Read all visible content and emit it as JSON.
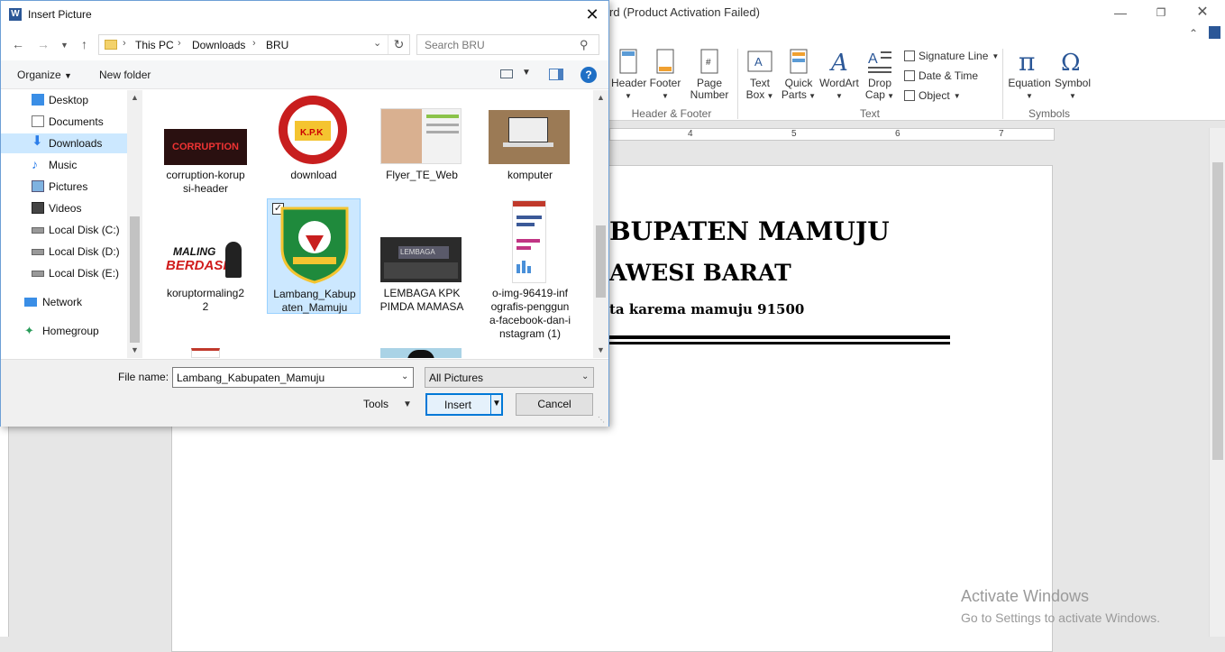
{
  "word": {
    "title": "rd (Product Activation Failed)",
    "ribbon": {
      "header_footer": {
        "header": "Header",
        "footer": "Footer",
        "page_number_line1": "Page",
        "page_number_line2": "Number",
        "group_label": "Header & Footer"
      },
      "text": {
        "text_box_line1": "Text",
        "text_box_line2": "Box",
        "quick_parts_line1": "Quick",
        "quick_parts_line2": "Parts",
        "wordart": "WordArt",
        "drop_cap_line1": "Drop",
        "drop_cap_line2": "Cap",
        "signature_line": "Signature Line",
        "date_time": "Date & Time",
        "object": "Object",
        "group_label": "Text"
      },
      "symbols": {
        "equation": "Equation",
        "symbol": "Symbol",
        "group_label": "Symbols"
      }
    },
    "ruler": [
      "4",
      "5",
      "6",
      "7"
    ],
    "document": {
      "line1": "BUPATEN MAMUJU",
      "line2": "AWESI BARAT",
      "line3": "ta karema mamuju 91500"
    },
    "activate": {
      "title": "Activate Windows",
      "subtitle": "Go to Settings to activate Windows."
    }
  },
  "dialog": {
    "title": "Insert Picture",
    "breadcrumb": [
      "This PC",
      "Downloads",
      "BRU"
    ],
    "search_placeholder": "Search BRU",
    "organize": "Organize",
    "new_folder": "New folder",
    "nav_items": [
      {
        "label": "Desktop",
        "icon": "desktop-icon"
      },
      {
        "label": "Documents",
        "icon": "documents-icon"
      },
      {
        "label": "Downloads",
        "icon": "downloads-icon"
      },
      {
        "label": "Music",
        "icon": "music-icon"
      },
      {
        "label": "Pictures",
        "icon": "pictures-icon"
      },
      {
        "label": "Videos",
        "icon": "videos-icon"
      },
      {
        "label": "Local Disk (C:)",
        "icon": "drive-icon"
      },
      {
        "label": "Local Disk (D:)",
        "icon": "drive-icon"
      },
      {
        "label": "Local Disk (E:)",
        "icon": "drive-icon"
      },
      {
        "label": "Network",
        "icon": "network-icon"
      },
      {
        "label": "Homegroup",
        "icon": "homegroup-icon"
      }
    ],
    "files": [
      {
        "name": "corruption-korup\nsi-header",
        "selected": false
      },
      {
        "name": "download",
        "selected": false
      },
      {
        "name": "Flyer_TE_Web",
        "selected": false
      },
      {
        "name": "komputer",
        "selected": false
      },
      {
        "name": "koruptormaling2\n2",
        "selected": false
      },
      {
        "name": "Lambang_Kabup\naten_Mamuju",
        "selected": true
      },
      {
        "name": "LEMBAGA KPK\nPIMDA MAMASA",
        "selected": false
      },
      {
        "name": "o-img-96419-inf\nografis-penggun\na-facebook-dan-i\nnstagram (1)",
        "selected": false
      }
    ],
    "thumb_text": {
      "corruption": "CORRUPTION",
      "kpk": "K.P.K",
      "maling": "MALING",
      "berdasi": "BERDASI",
      "lembaga": "LEMBAGA"
    },
    "file_name_label": "File name:",
    "file_name_value": "Lambang_Kabupaten_Mamuju",
    "file_type": "All Pictures",
    "tools": "Tools",
    "insert": "Insert",
    "cancel": "Cancel"
  },
  "colors": {
    "selection": "#cce8ff",
    "accent": "#0078d7",
    "word_blue": "#2b5797"
  }
}
